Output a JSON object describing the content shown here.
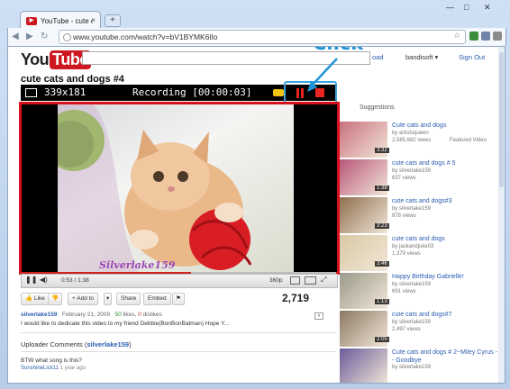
{
  "browser": {
    "tab_title": "YouTube - cute cats and d...",
    "tab_close": "×",
    "new_tab": "+",
    "url": "www.youtube.com/watch?v=bV1BYMK6lIo"
  },
  "header": {
    "logo_you": "You",
    "logo_tube": "Tube",
    "upload": "oad",
    "user": "bandisoft ▾",
    "sign_out": "Sign Out"
  },
  "video": {
    "title": "cute cats and dogs #4",
    "watermark": "Silverlake159",
    "time": "0:53 / 1:38",
    "quality": "360p",
    "progress": 0.54
  },
  "recorder": {
    "dimensions": "339x181",
    "status": "Recording [00:00:03]",
    "annotation": "Click"
  },
  "actions": {
    "like": "Like",
    "add_to": "+ Add to",
    "share": "Share",
    "embed": "Embed",
    "views": "2,719"
  },
  "meta": {
    "uploader": "silverlake159",
    "date": "February 21, 2009",
    "likes": "50",
    "likes_label": "likes,",
    "dislikes": "0",
    "dislikes_label": "dislikes",
    "description": "I would like to dedicate this video to my friend Debbie(BonBonBatman) Hope Y..."
  },
  "comments": {
    "heading_prefix": "Uploader Comments (",
    "heading_user": "silverlake159",
    "heading_suffix": ")",
    "text": "BTW what song is this?",
    "author": "SunshineLick11",
    "when": "1 year ago"
  },
  "suggestions": {
    "heading": "Suggestions",
    "items": [
      {
        "title": "Cute cats and dogs",
        "by": "by artistsqueen",
        "views": "2,585,682 views",
        "badge": "Featured Video",
        "duration": "3:32",
        "color": "#c9717e"
      },
      {
        "title": "cute cats and dogs # 5",
        "by": "by silverlake159",
        "views": "637 views",
        "duration": "1:38",
        "color": "#b8577a"
      },
      {
        "title": "cute cats and dogs#3",
        "by": "by silverlake159",
        "views": "878 views",
        "duration": "3:23",
        "color": "#8f6f4f"
      },
      {
        "title": "cute cats and dogs",
        "by": "by jackandjuke03",
        "views": "1,379 views",
        "duration": "3:46",
        "color": "#d8c9a4"
      },
      {
        "title": "Happy Birthday Gabrielle!",
        "by": "by silverlake159",
        "views": "691 views",
        "duration": "1:13",
        "color": "#9b9a8a"
      },
      {
        "title": "cute cats and dogs#7",
        "by": "by silverlake159",
        "views": "2,497 views",
        "duration": "2:05",
        "color": "#8b7a64"
      },
      {
        "title": "Cute cats and dogs # 2~Miley Cyrus -- Goodbye",
        "by": "by silverlake159",
        "views": "",
        "duration": "",
        "color": "#6a5b9a"
      }
    ]
  }
}
